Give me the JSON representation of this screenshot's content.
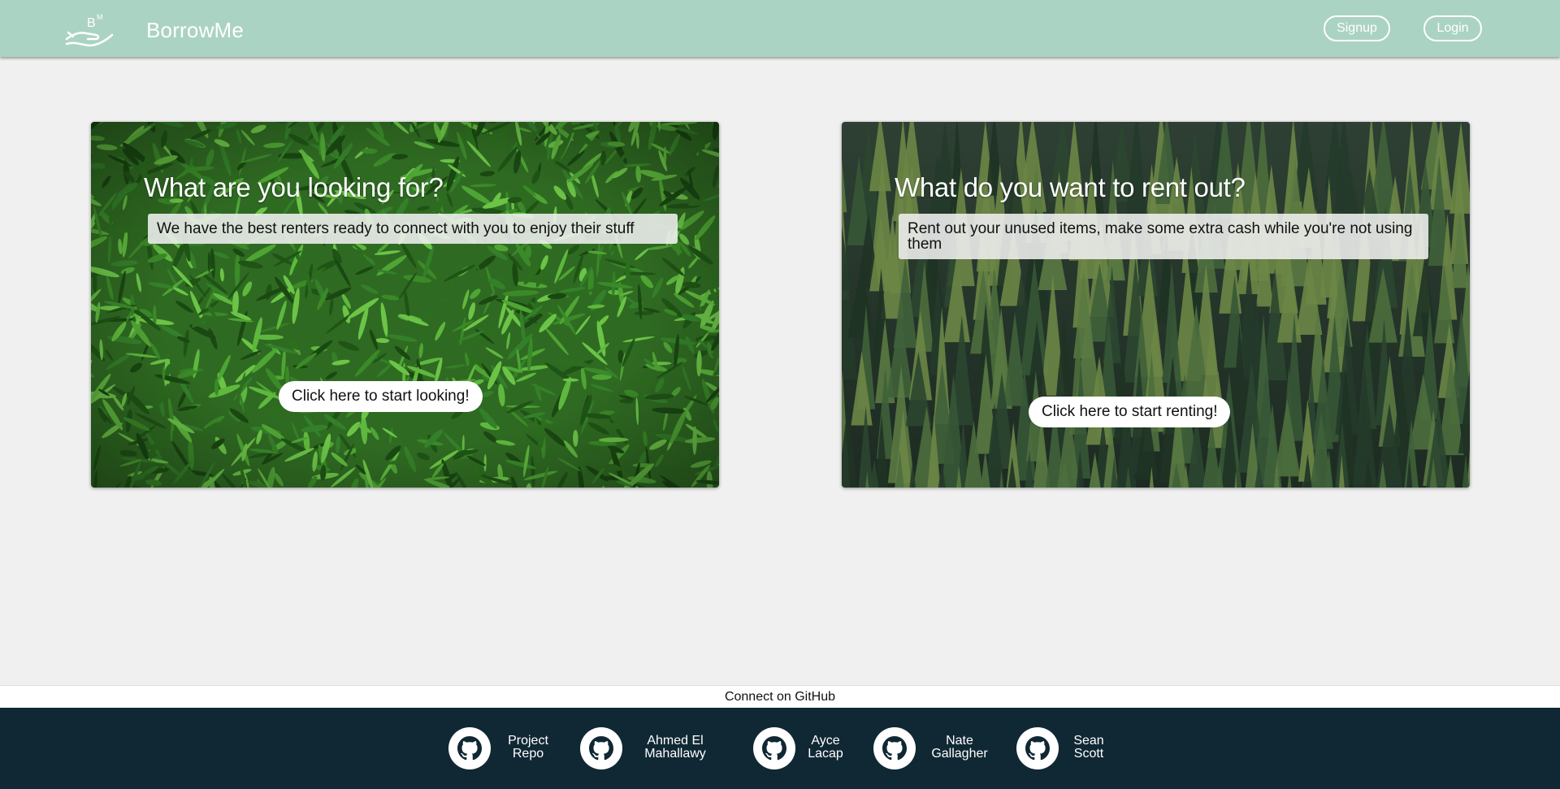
{
  "navbar": {
    "brand": "BorrowMe",
    "logo_letters": "BM",
    "signup_label": "Signup",
    "login_label": "Login",
    "background_color": "#abd3c3"
  },
  "cards": [
    {
      "title": "What are you looking for?",
      "description": "We have the best renters ready to connect with you to enjoy their stuff",
      "button_label": "Click here to start looking!",
      "background": "grass"
    },
    {
      "title": "What do you want to rent out?",
      "description": "Rent out your unused items, make some extra cash while you're not using them",
      "button_label": "Click here to start renting!",
      "background": "pine-forest"
    }
  ],
  "footer": {
    "connect_label": "Connect on GitHub",
    "background_color": "#102834",
    "links": [
      {
        "line1": "Project",
        "line2": "Repo",
        "icon": "github-icon"
      },
      {
        "line1": "Ahmed El",
        "line2": "Mahallawy",
        "icon": "github-icon"
      },
      {
        "line1": "Ayce",
        "line2": "Lacap",
        "icon": "github-icon"
      },
      {
        "line1": "Nate",
        "line2": "Gallagher",
        "icon": "github-icon"
      },
      {
        "line1": "Sean",
        "line2": "Scott",
        "icon": "github-icon"
      }
    ]
  }
}
